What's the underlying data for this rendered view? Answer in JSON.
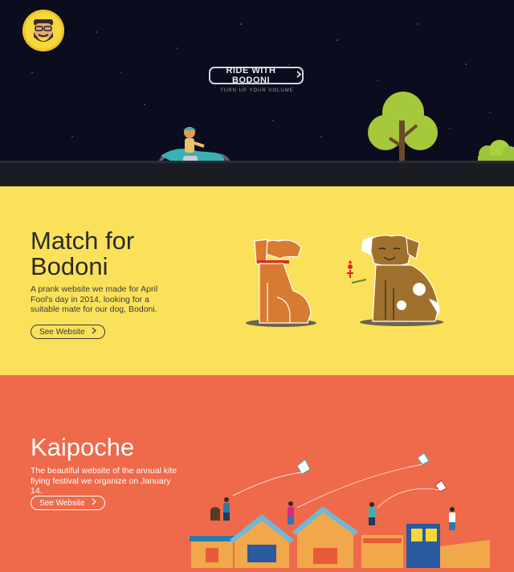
{
  "hero": {
    "cta_label": "RIDE WITH BODONI",
    "cta_icon": "chevron-right-icon",
    "subtitle": "TURN UP YOUR VOLUME",
    "bg_color": "#0b0c1d"
  },
  "projects": [
    {
      "title_line1": "Match for",
      "title_line2": "Bodoni",
      "description": "A prank website we made for April Fool's day in 2014, looking for a suitable mate for our dog, Bodoni.",
      "button_label": "See Website",
      "button_icon": "chevron-right-icon",
      "bg_color": "#fbe15a"
    },
    {
      "title": "Kaipoche",
      "description": "The beautiful website of the annual kite flying festival we organize on January 14.",
      "button_label": "See Website",
      "button_icon": "chevron-right-icon",
      "bg_color": "#ef6a4a"
    }
  ]
}
